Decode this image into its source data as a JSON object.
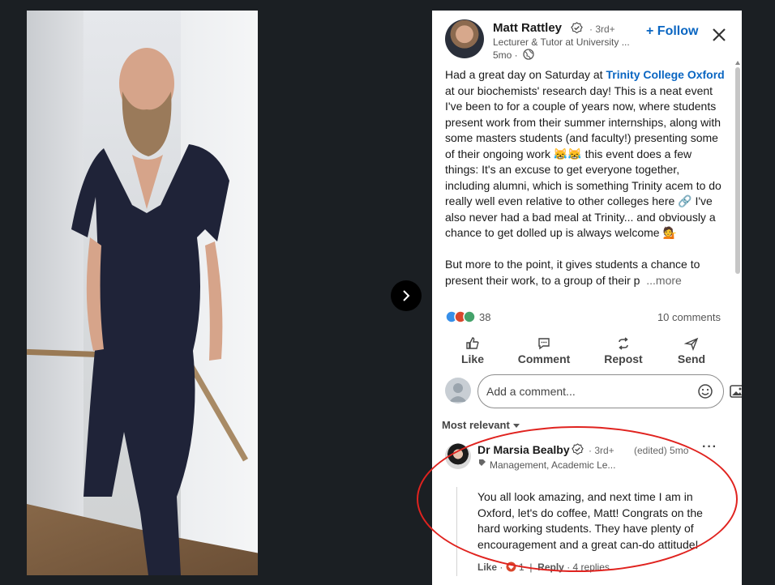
{
  "navigation": {
    "next_icon": "chevron-right-icon"
  },
  "post": {
    "author": {
      "name": "Matt Rattley",
      "degree": "· 3rd+",
      "headline": "Lecturer & Tutor at University ...",
      "time": "5mo ·",
      "verified_icon": "verified-icon",
      "visibility_icon": "globe-icon"
    },
    "follow_label": "+ Follow",
    "close_icon": "close-icon",
    "text": {
      "p1_pre": "Had a great day on Saturday at ",
      "p1_link": "Trinity College Oxford",
      "p1_post": " at our biochemists' research day! This is a neat event I've been to for a couple of years now, where students present work from their summer internships, along with some masters students (and faculty!) presenting some of their ongoing work 😹😹 this event does a few things: It's an excuse to get everyone together, including alumni, which is something Trinity acem to do really well even relative to other colleges here 🔗 I've also never had a bad meal at Trinity... and obviously a chance to get dolled up is always welcome 💁",
      "p2": "But more to the point, it gives students a chance to present their work, to a group of their p",
      "more": "...more"
    },
    "reactions": {
      "count": "38",
      "comments": "10 comments"
    },
    "actions": [
      {
        "label": "Like",
        "icon": "thumbs-up-icon"
      },
      {
        "label": "Comment",
        "icon": "comment-icon"
      },
      {
        "label": "Repost",
        "icon": "repost-icon"
      },
      {
        "label": "Send",
        "icon": "send-icon"
      }
    ],
    "comment_input": {
      "placeholder": "Add a comment..."
    },
    "sort_label": "Most relevant"
  },
  "comment": {
    "name": "Dr Marsia Bealby",
    "degree": "· 3rd+",
    "edited": "(edited) 5mo",
    "headline": "Management, Academic Le...",
    "text": "You all look amazing, and next time I am in Oxford, let's do coffee, Matt! Congrats on the hard working students. They have plenty of encouragement and a great can-do attitude!",
    "like_label": "Like",
    "reaction_count": "1",
    "reply_label": "Reply",
    "replies": "4 replies"
  },
  "colors": {
    "accent": "#0a66c2",
    "annotation": "#e0231f",
    "backdrop": "#1b1f23"
  }
}
